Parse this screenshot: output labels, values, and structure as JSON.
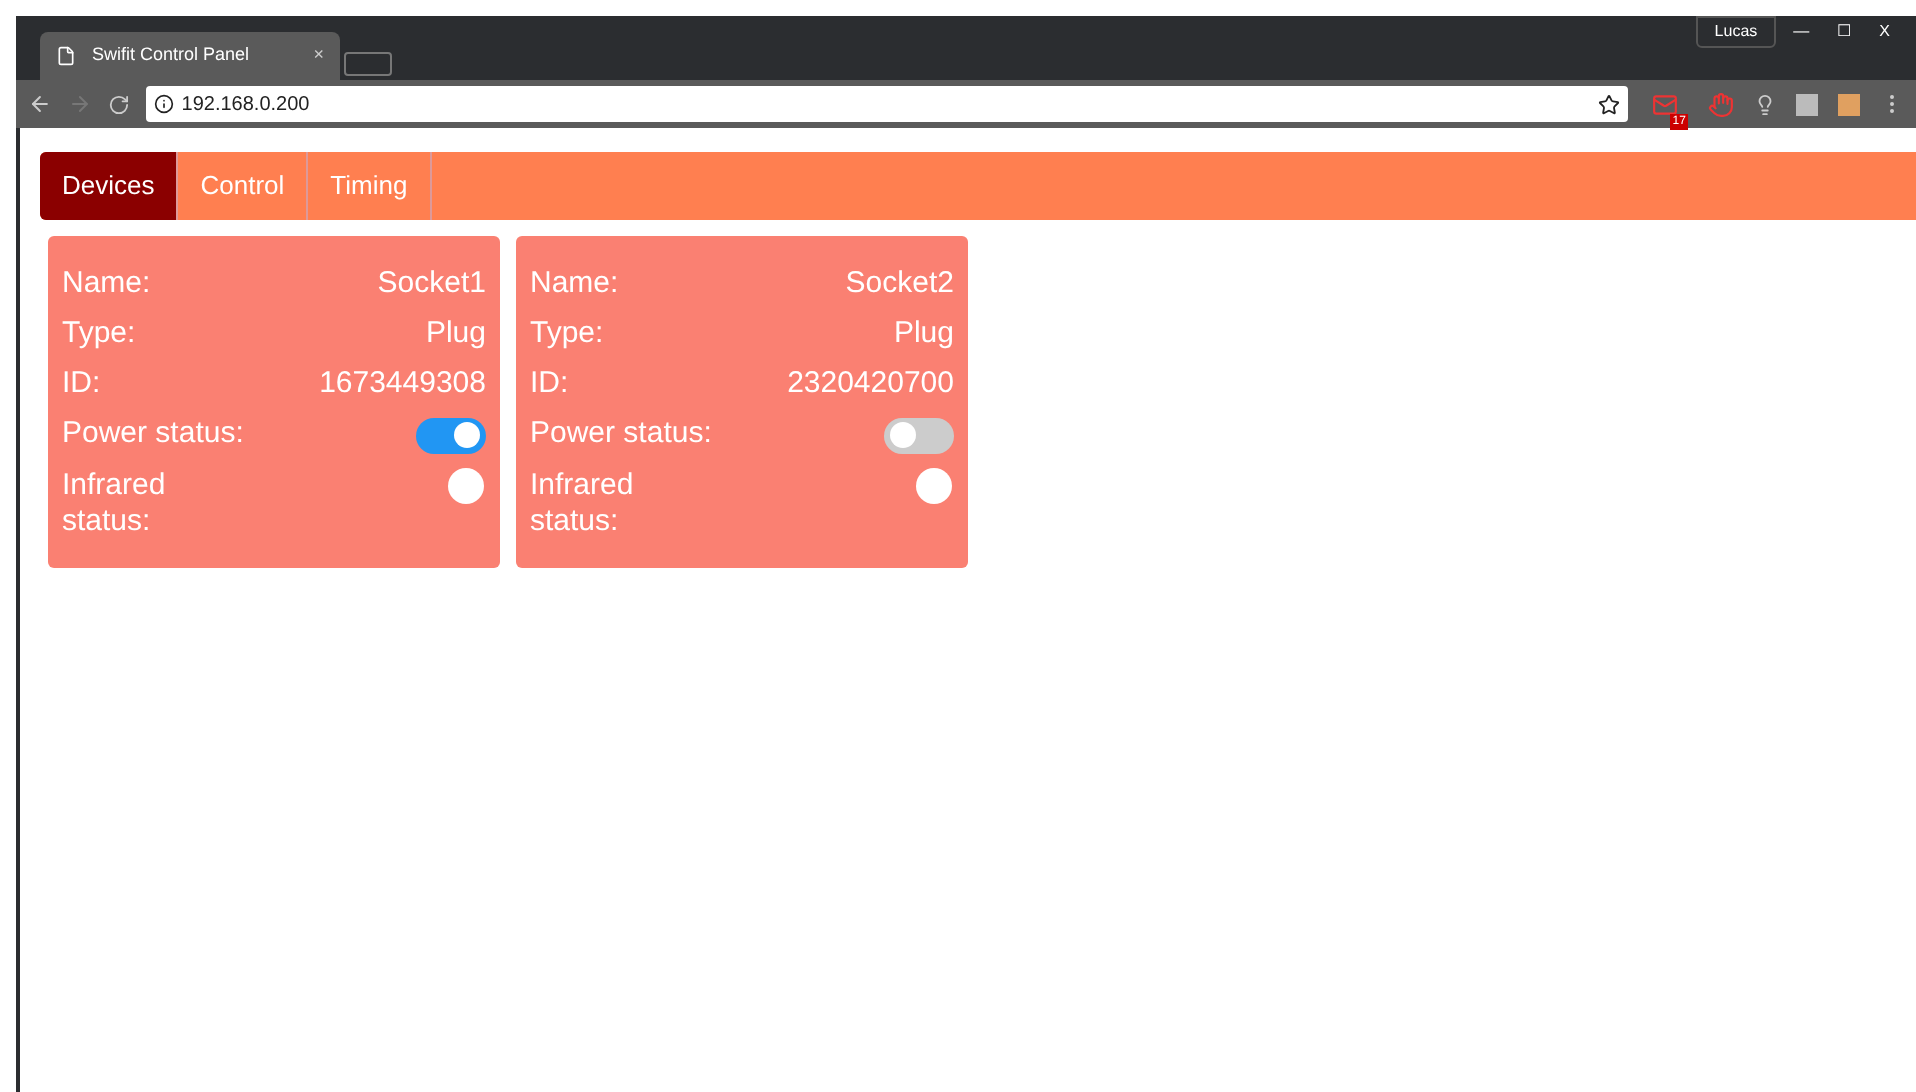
{
  "browser": {
    "tab_title": "Swifit Control Panel",
    "tab_close": "×",
    "user": "Lucas",
    "window_controls": [
      "—",
      "☐",
      "X"
    ],
    "address": "192.168.0.200",
    "mail_badge": "17"
  },
  "nav": [
    {
      "label": "Devices",
      "selected": true
    },
    {
      "label": "Control",
      "selected": false
    },
    {
      "label": "Timing",
      "selected": false
    }
  ],
  "devices": [
    {
      "name_label": "Name:",
      "name": "Socket1",
      "type_label": "Type:",
      "type": "Plug",
      "id_label": "ID:",
      "id": "1673449308",
      "power_label": "Power status:",
      "power_on": true,
      "infrared_label": "Infrared status:",
      "infrared_on": false
    },
    {
      "name_label": "Name:",
      "name": "Socket2",
      "type_label": "Type:",
      "type": "Plug",
      "id_label": "ID:",
      "id": "2320420700",
      "power_label": "Power status:",
      "power_on": false,
      "infrared_label": "Infrared status:",
      "infrared_on": false
    }
  ]
}
